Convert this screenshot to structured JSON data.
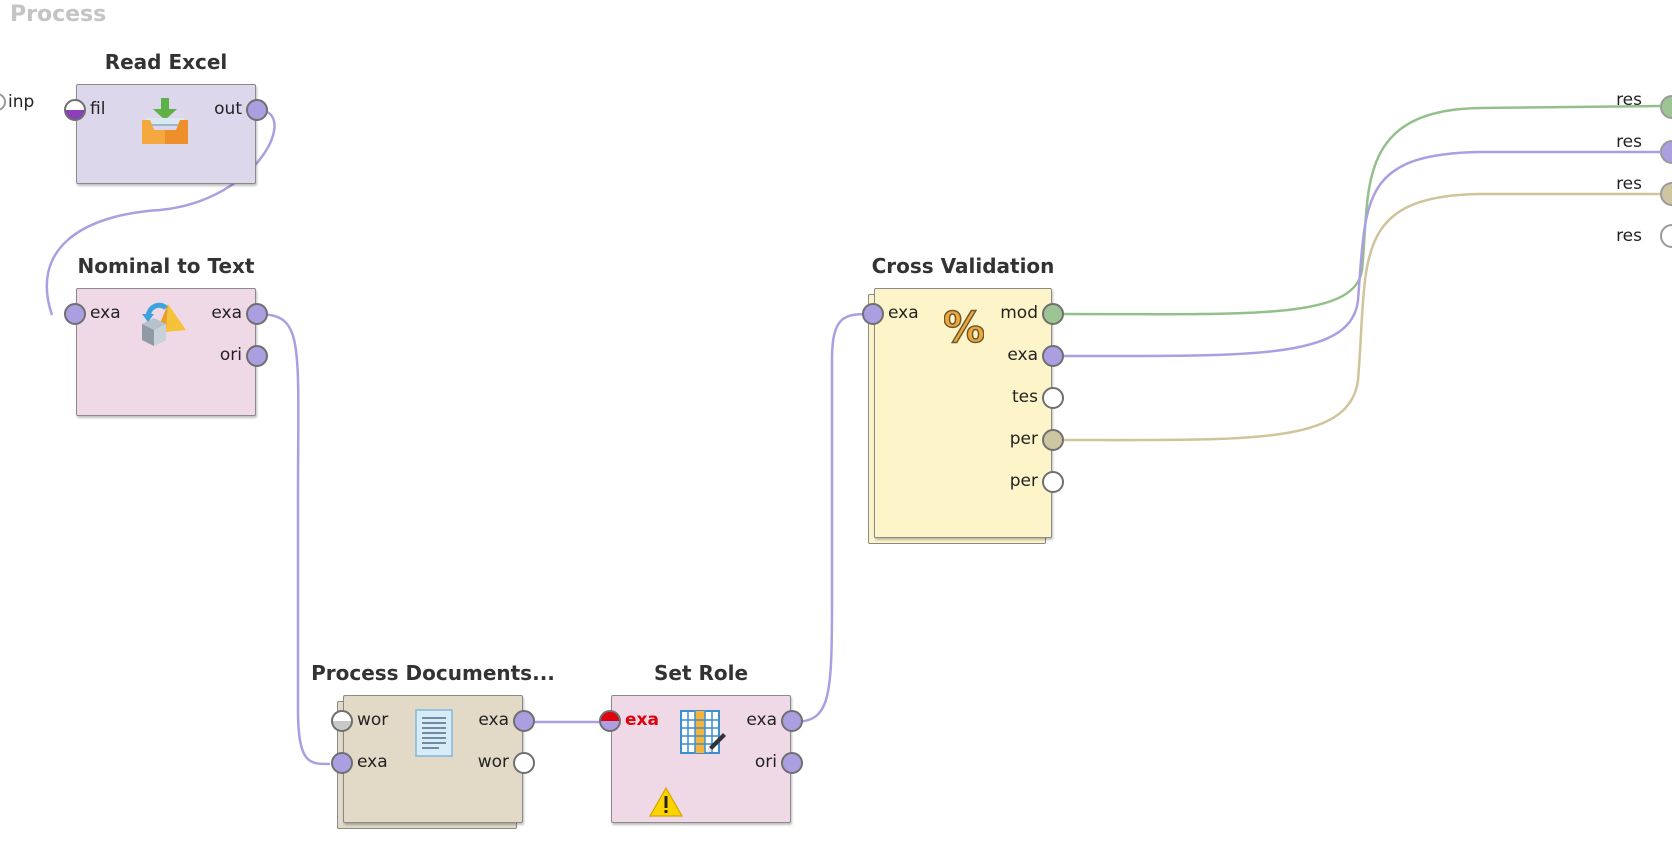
{
  "process": {
    "title": "Process"
  },
  "input_port": {
    "label": "inp"
  },
  "operators": {
    "read_excel": {
      "title": "Read Excel",
      "in": [
        "fil"
      ],
      "out": [
        "out"
      ]
    },
    "nominal_to_text": {
      "title": "Nominal to Text",
      "in": [
        "exa"
      ],
      "out": [
        "exa",
        "ori"
      ]
    },
    "process_documents": {
      "title": "Process Documents...",
      "in": [
        "wor",
        "exa"
      ],
      "out": [
        "exa",
        "wor"
      ]
    },
    "set_role": {
      "title": "Set Role",
      "in": [
        "exa"
      ],
      "out": [
        "exa",
        "ori"
      ]
    },
    "cross_validation": {
      "title": "Cross Validation",
      "in": [
        "exa"
      ],
      "out": [
        "mod",
        "exa",
        "tes",
        "per",
        "per"
      ]
    }
  },
  "result_ports": [
    "res",
    "res",
    "res",
    "res"
  ],
  "colors": {
    "example_set_wire": "#ab9fe2",
    "model_wire": "#93c08a",
    "performance_wire": "#cfc49a"
  },
  "icons": {
    "read_excel": "download-tray-icon",
    "nominal_to_text": "shapes-convert-icon",
    "process_documents": "document-icon",
    "set_role": "table-edit-icon",
    "cross_validation": "percent-icon",
    "warning": "warning-icon"
  }
}
